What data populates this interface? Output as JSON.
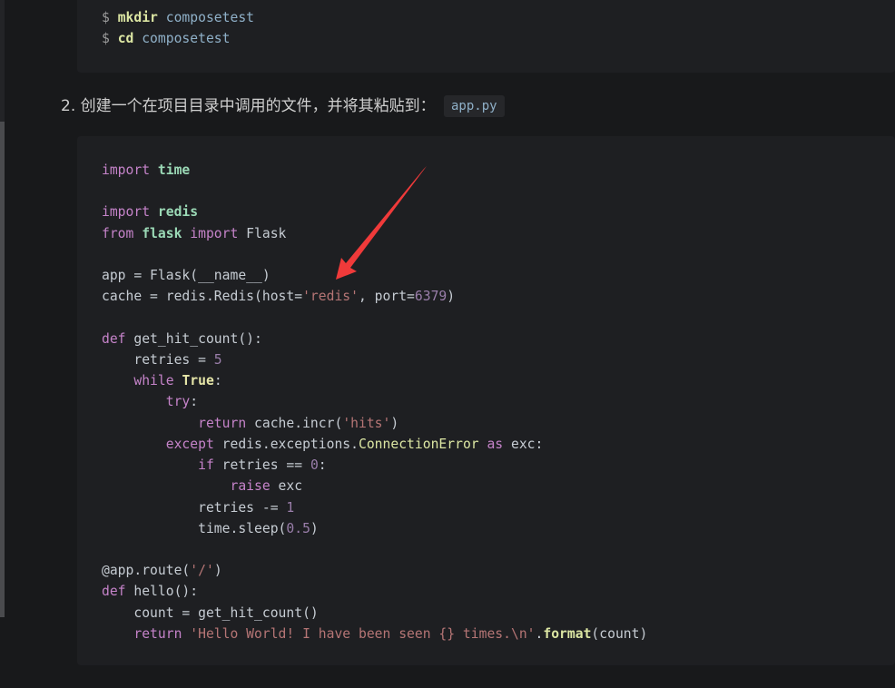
{
  "step_heading": "2. 创建一个在项目目录中调用的文件，并将其粘贴到：",
  "inline_code": "app.py",
  "annotation_color": "#f03a3a",
  "shell_block": [
    [
      [
        "prompt",
        "$ "
      ],
      [
        "cmd",
        "mkdir"
      ],
      [
        "arg",
        " composetest"
      ]
    ],
    [
      [
        "prompt",
        "$ "
      ],
      [
        "cmd",
        "cd"
      ],
      [
        "arg",
        " composetest"
      ]
    ]
  ],
  "python_block": [
    [
      [
        "kw",
        "import"
      ],
      [
        "txt",
        " "
      ],
      [
        "mod",
        "time"
      ]
    ],
    [],
    [
      [
        "kw",
        "import"
      ],
      [
        "txt",
        " "
      ],
      [
        "mod",
        "redis"
      ]
    ],
    [
      [
        "kw",
        "from"
      ],
      [
        "txt",
        " "
      ],
      [
        "mod",
        "flask"
      ],
      [
        "txt",
        " "
      ],
      [
        "kw",
        "import"
      ],
      [
        "txt",
        " Flask"
      ]
    ],
    [],
    [
      [
        "txt",
        "app = Flask(__name__)"
      ]
    ],
    [
      [
        "txt",
        "cache = redis.Redis(host="
      ],
      [
        "str",
        "'redis'"
      ],
      [
        "txt",
        ", port="
      ],
      [
        "num",
        "6379"
      ],
      [
        "txt",
        ")"
      ]
    ],
    [],
    [
      [
        "kw",
        "def"
      ],
      [
        "txt",
        " get_hit_count():"
      ]
    ],
    [
      [
        "txt",
        "    retries = "
      ],
      [
        "num",
        "5"
      ]
    ],
    [
      [
        "txt",
        "    "
      ],
      [
        "kw",
        "while"
      ],
      [
        "txt",
        " "
      ],
      [
        "bool",
        "True"
      ],
      [
        "txt",
        ":"
      ]
    ],
    [
      [
        "txt",
        "        "
      ],
      [
        "kw",
        "try"
      ],
      [
        "txt",
        ":"
      ]
    ],
    [
      [
        "txt",
        "            "
      ],
      [
        "kw",
        "return"
      ],
      [
        "txt",
        " cache.incr("
      ],
      [
        "str",
        "'hits'"
      ],
      [
        "txt",
        ")"
      ]
    ],
    [
      [
        "txt",
        "        "
      ],
      [
        "kw",
        "except"
      ],
      [
        "txt",
        " redis.exceptions."
      ],
      [
        "cls",
        "ConnectionError"
      ],
      [
        "txt",
        " "
      ],
      [
        "kw",
        "as"
      ],
      [
        "txt",
        " exc:"
      ]
    ],
    [
      [
        "txt",
        "            "
      ],
      [
        "kw",
        "if"
      ],
      [
        "txt",
        " retries == "
      ],
      [
        "num",
        "0"
      ],
      [
        "txt",
        ":"
      ]
    ],
    [
      [
        "txt",
        "                "
      ],
      [
        "kw",
        "raise"
      ],
      [
        "txt",
        " exc"
      ]
    ],
    [
      [
        "txt",
        "            retries -= "
      ],
      [
        "num",
        "1"
      ]
    ],
    [
      [
        "txt",
        "            time.sleep("
      ],
      [
        "num",
        "0.5"
      ],
      [
        "txt",
        ")"
      ]
    ],
    [],
    [
      [
        "txt",
        "@app.route("
      ],
      [
        "str",
        "'/'"
      ],
      [
        "txt",
        ")"
      ]
    ],
    [
      [
        "kw",
        "def"
      ],
      [
        "txt",
        " hello():"
      ]
    ],
    [
      [
        "txt",
        "    count = get_hit_count()"
      ]
    ],
    [
      [
        "txt",
        "    "
      ],
      [
        "kw",
        "return"
      ],
      [
        "txt",
        " "
      ],
      [
        "str",
        "'Hello World! I have been seen {} times.\\n'"
      ],
      [
        "txt",
        "."
      ],
      [
        "fn",
        "format"
      ],
      [
        "txt",
        "(count)"
      ]
    ]
  ]
}
